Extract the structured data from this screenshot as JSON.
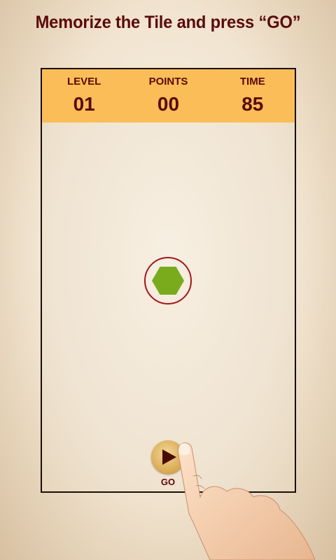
{
  "instruction": "Memorize the Tile and press “GO”",
  "stats": [
    {
      "label": "LEVEL",
      "value": "01"
    },
    {
      "label": "POINTS",
      "value": "00"
    },
    {
      "label": "TIME",
      "value": "85"
    }
  ],
  "tile": {
    "shape": "hexagon-icon",
    "color": "#7aab1d"
  },
  "go_button": {
    "label": "GO",
    "icon": "play-icon"
  },
  "colors": {
    "title": "#5a0a0a",
    "stats_bar": "#fbbd57",
    "ring": "#a01818"
  }
}
